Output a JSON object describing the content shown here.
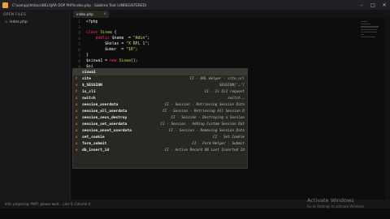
{
  "window": {
    "title": "C:\\xampp\\htdocs\\BELAJAR OOP PHP\\index.php - Sublime Text (UNREGISTERED)"
  },
  "sidebar": {
    "header": "OPEN FILES",
    "files": [
      {
        "icon": "file-icon",
        "name": "index.php"
      }
    ]
  },
  "tabs": [
    {
      "label": "index.php",
      "active": true
    }
  ],
  "editor": {
    "line_numbers": [
      "1",
      "2",
      "3",
      "4",
      "5",
      "6",
      "7",
      "8",
      "9",
      "10",
      "11",
      "12",
      "13",
      "14",
      "15",
      "16",
      "17",
      "18",
      "19",
      "20",
      "21",
      "22",
      "23",
      "24"
    ],
    "code": {
      "l1": "<?php",
      "l3_kw": "class",
      "l3_fn": "Siswa",
      "l3_rest": " {",
      "l4_kw": "public",
      "l4_rest": " $nama  = ",
      "l4_str": "\"Adin\"",
      "l4_end": ";",
      "l5_rest": "        $kelas = ",
      "l5_str": "\"X RPL 1\"",
      "l5_end": ";",
      "l6_rest": "        $umur  = ",
      "l6_str": "\"16\"",
      "l6_end": ";",
      "l7": "}",
      "l8_var": "$siswa1",
      "l8_mid": " = ",
      "l8_kw": "new",
      "l8_fn": " Siswa",
      "l8_end": "();",
      "l9": "$si"
    }
  },
  "autocomplete": {
    "items": [
      {
        "kind": "",
        "trigger": "siswa1",
        "annotation": "",
        "selected": true
      },
      {
        "kind": "f",
        "trigger": "site",
        "annotation": "CI - URL Helper - site_url",
        "selected": false
      },
      {
        "kind": "v",
        "trigger": "$_SESSION",
        "annotation": "SESSION['…']",
        "selected": false
      },
      {
        "kind": "f",
        "trigger": "is_cli",
        "annotation": "CI - Is CLI request",
        "selected": false
      },
      {
        "kind": "s",
        "trigger": "switch",
        "annotation": "switch …",
        "selected": false
      },
      {
        "kind": "s",
        "trigger": "session_userdata",
        "annotation": "CI - Session - Retrieving Session Data",
        "selected": false
      },
      {
        "kind": "s",
        "trigger": "session_all_userdata",
        "annotation": "CI - Session - Retrieving All Session D",
        "selected": false
      },
      {
        "kind": "s",
        "trigger": "session_sess_destroy",
        "annotation": "CI - Session - Destroying a Session",
        "selected": false
      },
      {
        "kind": "s",
        "trigger": "session_set_userdata",
        "annotation": "CI - Session - Adding Custom Session Dat",
        "selected": false
      },
      {
        "kind": "s",
        "trigger": "session_unset_userdata",
        "annotation": "CI - Session - Removing Session Data",
        "selected": false
      },
      {
        "kind": "s",
        "trigger": "set_cookie",
        "annotation": "CI - Set Cookie",
        "selected": false
      },
      {
        "kind": "s",
        "trigger": "form_submit",
        "annotation": "CI - Form Helper - Submit",
        "selected": false
      },
      {
        "kind": "s",
        "trigger": "db_insert_id",
        "annotation": "CI - Active Record DB Last Inserted Id",
        "selected": false
      }
    ]
  },
  "statusbar": {
    "text": "Info: preparing 'PHP': please wait... Line 9, Column 4"
  },
  "watermark": {
    "line1": "Activate Windows",
    "line2": "Go to Settings to activate Windows."
  },
  "colors": {
    "editor_bg": "#0d0d0d",
    "keyword": "#f92672",
    "function": "#a6e22e",
    "string": "#e6db74"
  }
}
